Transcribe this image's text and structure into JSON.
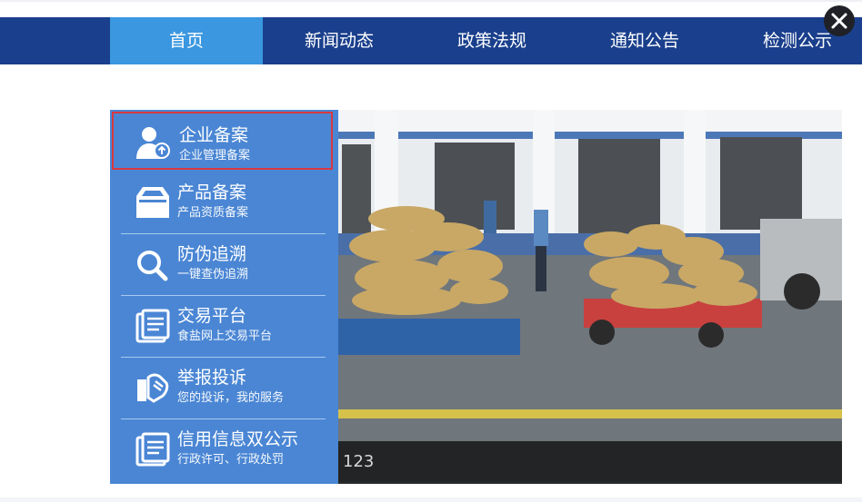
{
  "nav": {
    "items": [
      "首页",
      "新闻动态",
      "政策法规",
      "通知公告",
      "检测公示"
    ],
    "active_index": 0
  },
  "close_icon": "close-icon",
  "side_menu": [
    {
      "title": "企业备案",
      "subtitle": "企业管理备案",
      "icon": "user-upload-icon"
    },
    {
      "title": "产品备案",
      "subtitle": "产品资质备案",
      "icon": "product-box-icon"
    },
    {
      "title": "防伪追溯",
      "subtitle": "一键查伪追溯",
      "icon": "search-icon"
    },
    {
      "title": "交易平台",
      "subtitle": "食盐网上交易平台",
      "icon": "invoice-icon"
    },
    {
      "title": "举报投诉",
      "subtitle": "您的投诉，我的服务",
      "icon": "complaint-icon"
    },
    {
      "title": "信用信息双公示",
      "subtitle": "行政许可、行政处罚",
      "icon": "document-icon"
    }
  ],
  "banner": {
    "caption": "123"
  },
  "colors": {
    "nav_bg": "#1a3f8c",
    "nav_active": "#3a97e0",
    "panel_bg": "#4a86d4",
    "highlight_border": "#d9383f"
  }
}
